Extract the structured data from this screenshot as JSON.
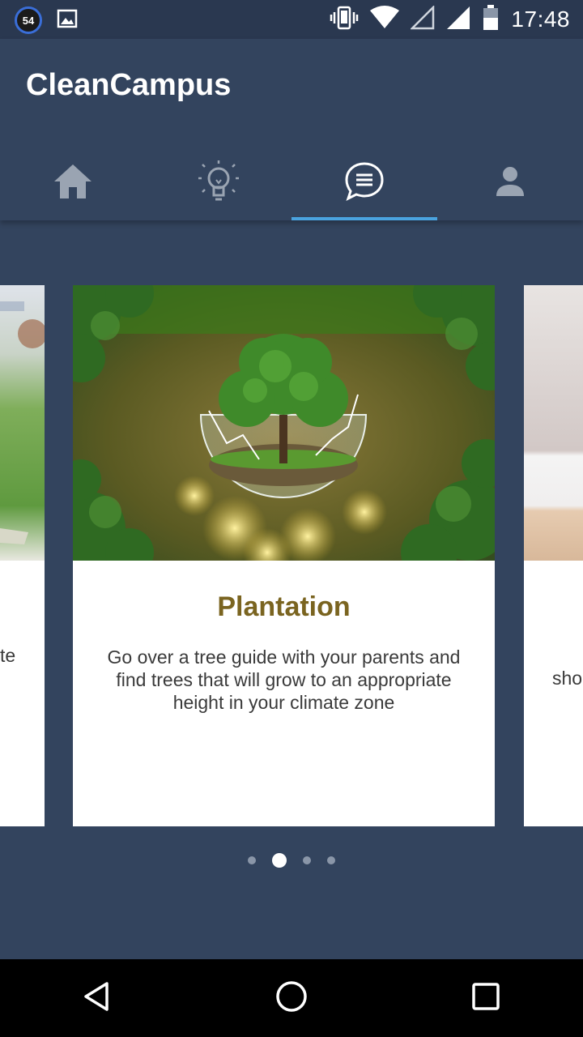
{
  "status_bar": {
    "notification_count": "54",
    "time": "17:48",
    "icons": [
      "notification-badge",
      "image-icon",
      "vibrate-icon",
      "wifi-icon",
      "signal-empty-icon",
      "signal-full-icon",
      "battery-icon"
    ]
  },
  "app": {
    "title": "CleanCampus"
  },
  "tabs": [
    {
      "name": "home",
      "icon": "home-icon",
      "active": false
    },
    {
      "name": "ideas",
      "icon": "lightbulb-icon",
      "active": false
    },
    {
      "name": "messages",
      "icon": "chat-icon",
      "active": true
    },
    {
      "name": "profile",
      "icon": "person-icon",
      "active": false
    }
  ],
  "carousel": {
    "current_index": 1,
    "total": 4,
    "left_card": {
      "partial_text": "te"
    },
    "main_card": {
      "title": "Plantation",
      "description": "Go over a tree guide with your parents and find trees that will grow to an appropriate height in your climate zone"
    },
    "right_card": {
      "partial_text": "sho"
    }
  },
  "colors": {
    "background": "#33445e",
    "status_bar": "#2a3850",
    "tab_indicator": "#4aa3df",
    "card_title": "#7a6420"
  },
  "nav_bar": {
    "buttons": [
      "back-icon",
      "home-circle-icon",
      "recents-icon"
    ]
  }
}
